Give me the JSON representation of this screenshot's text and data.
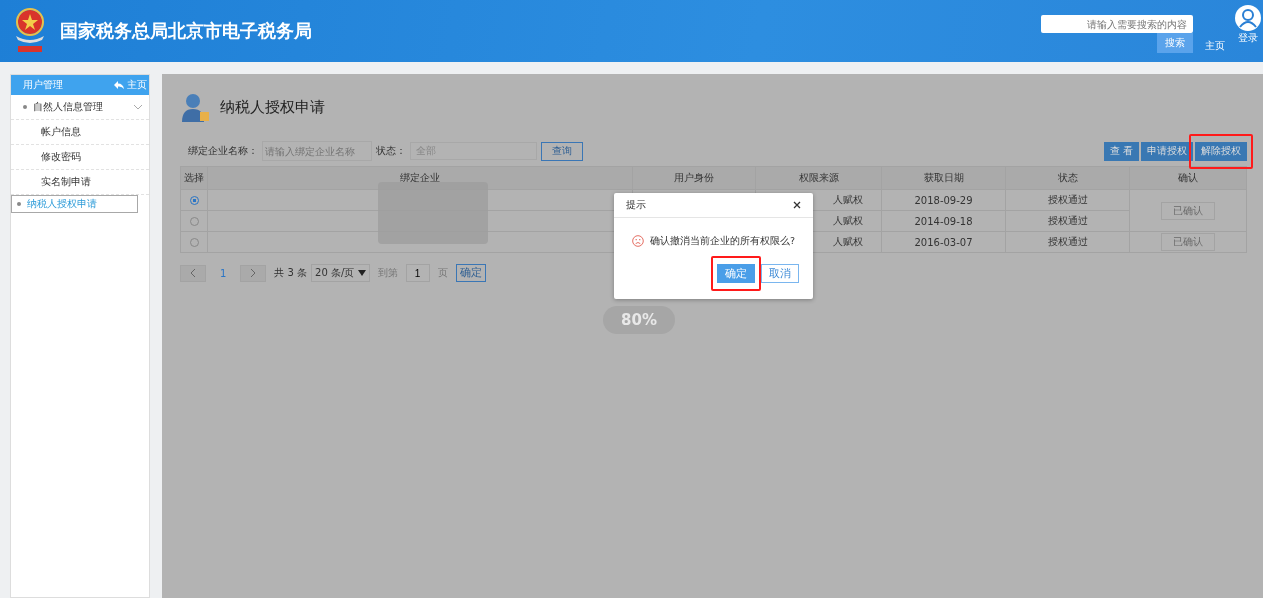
{
  "header": {
    "title": "国家税务总局北京市电子税务局",
    "search": {
      "placeholder": "请输入需要搜索的内容",
      "button": "搜索"
    },
    "home_link": "主页",
    "login": "登录"
  },
  "sidebar": {
    "title": "用户管理",
    "home": "主页",
    "items": [
      {
        "label": "自然人信息管理",
        "expanded": true,
        "selected": false,
        "children": [
          {
            "label": "帐户信息",
            "selected": false
          },
          {
            "label": "修改密码",
            "selected": false
          },
          {
            "label": "实名制申请",
            "selected": false
          }
        ]
      },
      {
        "label": "纳税人授权申请",
        "expanded": false,
        "selected": true
      }
    ]
  },
  "page": {
    "title": "纳税人授权申请",
    "filters": {
      "company_label": "绑定企业名称：",
      "company_placeholder": "请输入绑定企业名称",
      "status_label": "状态：",
      "status_value": "全部",
      "query": "查询"
    },
    "actions": [
      {
        "label": "查 看",
        "highlighted": false
      },
      {
        "label": "申请授权",
        "highlighted": false
      },
      {
        "label": "解除授权",
        "highlighted": true
      }
    ],
    "table": {
      "columns": [
        "选择",
        "绑定企业",
        "用户身份",
        "权限来源",
        "获取日期",
        "状态",
        "确认"
      ],
      "rows": [
        {
          "selected": true,
          "source": "人赋权",
          "date": "2018-09-29",
          "status": "授权通过"
        },
        {
          "selected": false,
          "source": "人赋权",
          "date": "2014-09-18",
          "status": "授权通过"
        },
        {
          "selected": false,
          "source": "人赋权",
          "date": "2016-03-07",
          "status": "授权通过"
        }
      ],
      "confirm_buttons": [
        "已确认",
        "已确认"
      ]
    },
    "pagination": {
      "page": "1",
      "total": "共 3 条",
      "page_size": "20 条/页",
      "goto": "到第",
      "goto_value": "1",
      "page_unit": "页",
      "go": "确定"
    },
    "loading": "80%"
  },
  "dialog": {
    "title": "提示",
    "message": "确认撤消当前企业的所有权限么?",
    "ok": "确定",
    "cancel": "取消",
    "ok_highlighted": true
  }
}
